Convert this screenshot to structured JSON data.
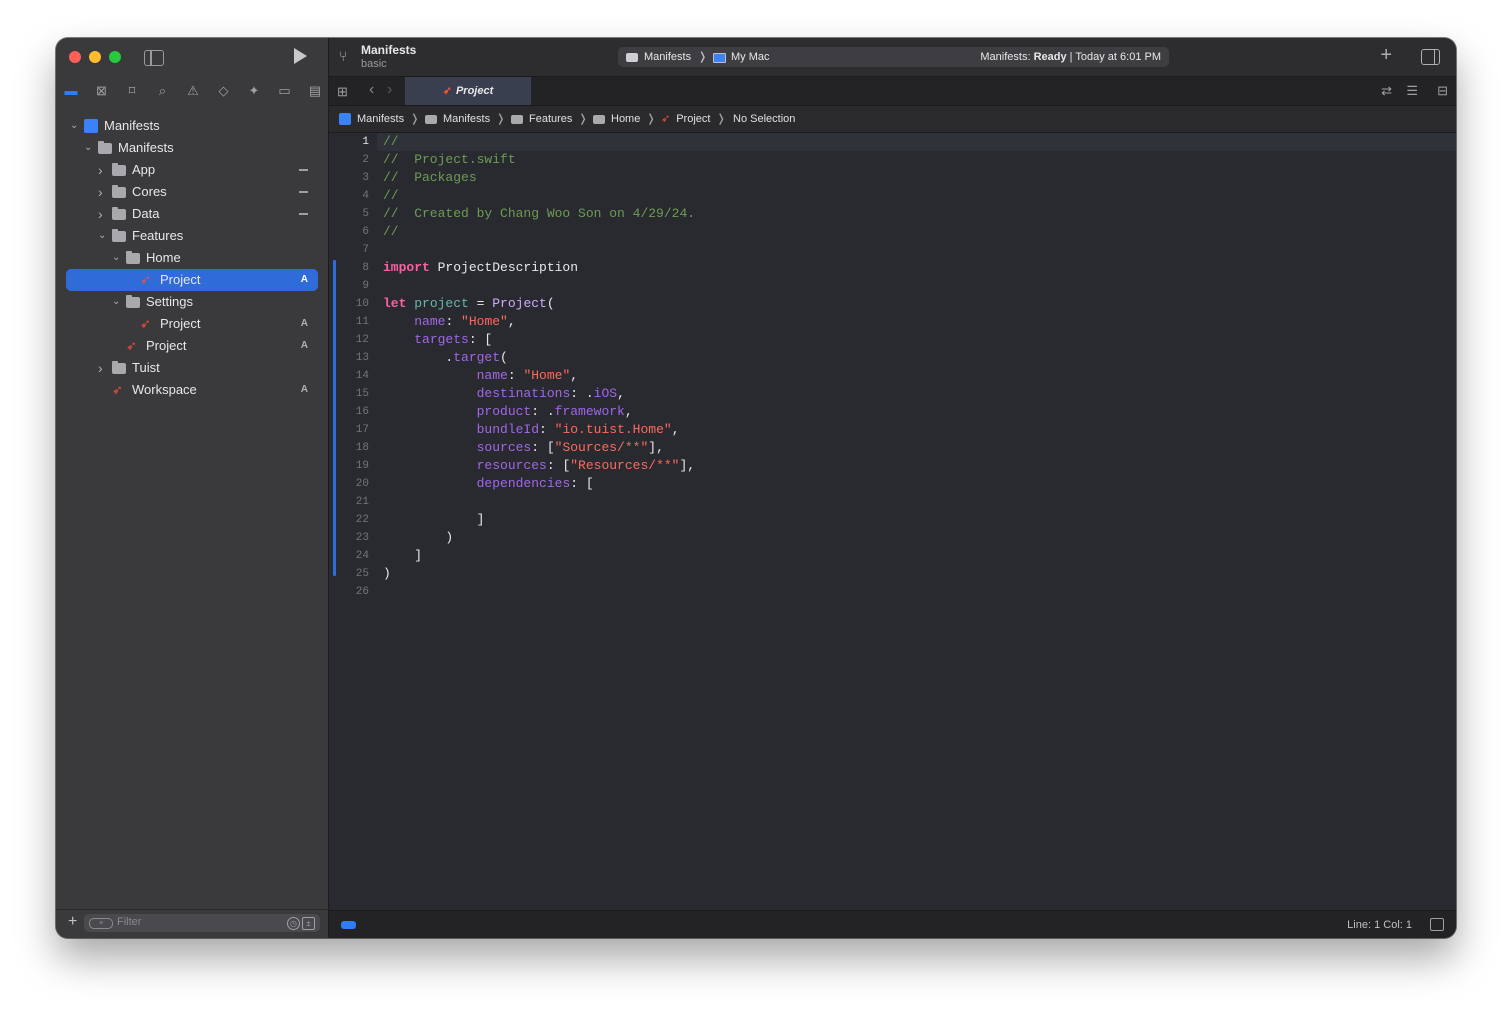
{
  "window": {
    "project_title": "Manifests",
    "project_subtitle": "basic"
  },
  "scheme": {
    "target": "Manifests",
    "destination": "My Mac",
    "status_prefix": "Manifests:",
    "status_state": "Ready",
    "status_time": "| Today at 6:01 PM"
  },
  "navigator_icons": [
    "folder-icon",
    "source-control-icon",
    "bookmark-icon",
    "find-icon",
    "issue-icon",
    "test-icon",
    "debug-icon",
    "breakpoint-icon",
    "report-icon"
  ],
  "tree": [
    {
      "label": "Manifests",
      "depth": 0,
      "icon": "project",
      "chev": "down",
      "badge": "",
      "dash": false,
      "selected": false
    },
    {
      "label": "Manifests",
      "depth": 1,
      "icon": "folder",
      "chev": "down",
      "badge": "",
      "dash": false,
      "selected": false
    },
    {
      "label": "App",
      "depth": 2,
      "icon": "folder",
      "chev": "right",
      "badge": "",
      "dash": true,
      "selected": false
    },
    {
      "label": "Cores",
      "depth": 2,
      "icon": "folder",
      "chev": "right",
      "badge": "",
      "dash": true,
      "selected": false
    },
    {
      "label": "Data",
      "depth": 2,
      "icon": "folder",
      "chev": "right",
      "badge": "",
      "dash": true,
      "selected": false
    },
    {
      "label": "Features",
      "depth": 2,
      "icon": "folder",
      "chev": "down",
      "badge": "",
      "dash": false,
      "selected": false
    },
    {
      "label": "Home",
      "depth": 3,
      "icon": "folder",
      "chev": "down",
      "badge": "",
      "dash": false,
      "selected": false
    },
    {
      "label": "Project",
      "depth": 4,
      "icon": "swift",
      "chev": "",
      "badge": "A",
      "dash": false,
      "selected": true
    },
    {
      "label": "Settings",
      "depth": 3,
      "icon": "folder",
      "chev": "down",
      "badge": "",
      "dash": false,
      "selected": false
    },
    {
      "label": "Project",
      "depth": 4,
      "icon": "swift",
      "chev": "",
      "badge": "A",
      "dash": false,
      "selected": false
    },
    {
      "label": "Project",
      "depth": 3,
      "icon": "swift",
      "chev": "",
      "badge": "A",
      "dash": false,
      "selected": false
    },
    {
      "label": "Tuist",
      "depth": 2,
      "icon": "folder",
      "chev": "right",
      "badge": "",
      "dash": false,
      "selected": false
    },
    {
      "label": "Workspace",
      "depth": 2,
      "icon": "swift",
      "chev": "",
      "badge": "A",
      "dash": false,
      "selected": false
    }
  ],
  "filter": {
    "placeholder": "Filter"
  },
  "tab": {
    "label": "Project"
  },
  "breadcrumb": [
    {
      "label": "Manifests",
      "icon": "project"
    },
    {
      "label": "Manifests",
      "icon": "folder"
    },
    {
      "label": "Features",
      "icon": "folder"
    },
    {
      "label": "Home",
      "icon": "folder"
    },
    {
      "label": "Project",
      "icon": "swift"
    },
    {
      "label": "No Selection",
      "icon": ""
    }
  ],
  "code_lines": [
    [
      [
        "c-com",
        "//"
      ]
    ],
    [
      [
        "c-com",
        "//  Project.swift"
      ]
    ],
    [
      [
        "c-com",
        "//  Packages"
      ]
    ],
    [
      [
        "c-com",
        "//"
      ]
    ],
    [
      [
        "c-com",
        "//  Created by Chang Woo Son on 4/29/24."
      ]
    ],
    [
      [
        "c-com",
        "//"
      ]
    ],
    [],
    [
      [
        "c-kw",
        "import"
      ],
      [
        "c-plain",
        " ProjectDescription"
      ]
    ],
    [],
    [
      [
        "c-kw",
        "let"
      ],
      [
        "c-plain",
        " "
      ],
      [
        "c-var",
        "project"
      ],
      [
        "c-plain",
        " = "
      ],
      [
        "c-type",
        "Project"
      ],
      [
        "c-plain",
        "("
      ]
    ],
    [
      [
        "c-plain",
        "    "
      ],
      [
        "c-prop",
        "name"
      ],
      [
        "c-plain",
        ": "
      ],
      [
        "c-str",
        "\"Home\""
      ],
      [
        "c-plain",
        ","
      ]
    ],
    [
      [
        "c-plain",
        "    "
      ],
      [
        "c-prop",
        "targets"
      ],
      [
        "c-plain",
        ": ["
      ]
    ],
    [
      [
        "c-plain",
        "        ."
      ],
      [
        "c-prop",
        "target"
      ],
      [
        "c-plain",
        "("
      ]
    ],
    [
      [
        "c-plain",
        "            "
      ],
      [
        "c-prop",
        "name"
      ],
      [
        "c-plain",
        ": "
      ],
      [
        "c-str",
        "\"Home\""
      ],
      [
        "c-plain",
        ","
      ]
    ],
    [
      [
        "c-plain",
        "            "
      ],
      [
        "c-prop",
        "destinations"
      ],
      [
        "c-plain",
        ": ."
      ],
      [
        "c-prop",
        "iOS"
      ],
      [
        "c-plain",
        ","
      ]
    ],
    [
      [
        "c-plain",
        "            "
      ],
      [
        "c-prop",
        "product"
      ],
      [
        "c-plain",
        ": ."
      ],
      [
        "c-prop",
        "framework"
      ],
      [
        "c-plain",
        ","
      ]
    ],
    [
      [
        "c-plain",
        "            "
      ],
      [
        "c-prop",
        "bundleId"
      ],
      [
        "c-plain",
        ": "
      ],
      [
        "c-str",
        "\"io.tuist.Home\""
      ],
      [
        "c-plain",
        ","
      ]
    ],
    [
      [
        "c-plain",
        "            "
      ],
      [
        "c-prop",
        "sources"
      ],
      [
        "c-plain",
        ": ["
      ],
      [
        "c-str",
        "\"Sources/**\""
      ],
      [
        "c-plain",
        "],"
      ]
    ],
    [
      [
        "c-plain",
        "            "
      ],
      [
        "c-prop",
        "resources"
      ],
      [
        "c-plain",
        ": ["
      ],
      [
        "c-str",
        "\"Resources/**\""
      ],
      [
        "c-plain",
        "],"
      ]
    ],
    [
      [
        "c-plain",
        "            "
      ],
      [
        "c-prop",
        "dependencies"
      ],
      [
        "c-plain",
        ": ["
      ]
    ],
    [],
    [
      [
        "c-plain",
        "            ]"
      ]
    ],
    [
      [
        "c-plain",
        "        )"
      ]
    ],
    [
      [
        "c-plain",
        "    ]"
      ]
    ],
    [
      [
        "c-plain",
        ")"
      ]
    ],
    []
  ],
  "status": {
    "position": "Line: 1  Col: 1"
  }
}
